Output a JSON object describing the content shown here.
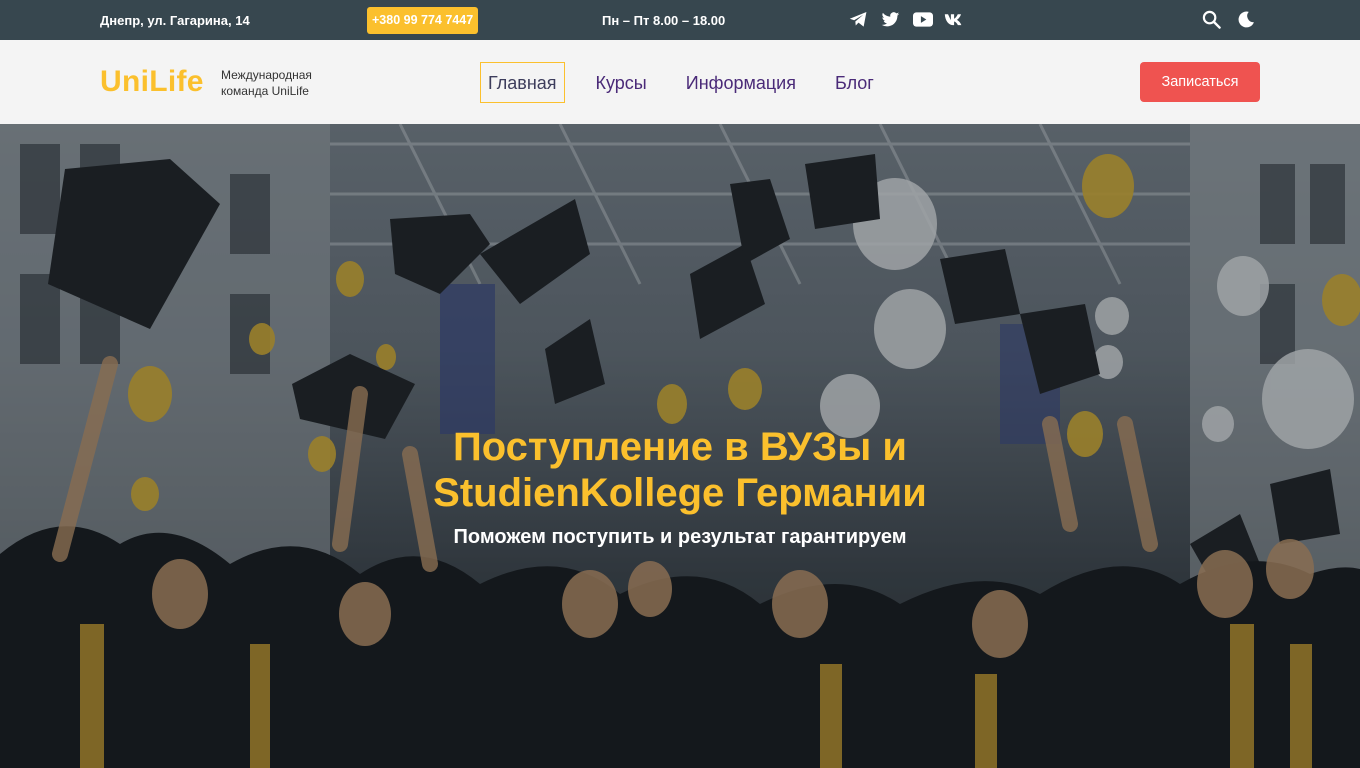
{
  "topbar": {
    "address": "Днепр, ул. Гагарина, 14",
    "phone": "+380 99 774 7447",
    "hours": "Пн – Пт 8.00 – 18.00",
    "socials": [
      "telegram-icon",
      "twitter-icon",
      "youtube-icon",
      "vk-icon"
    ],
    "tools": [
      "search-icon",
      "moon-icon"
    ]
  },
  "header": {
    "logo": "UniLife",
    "tagline": "Международная команда UniLife",
    "nav": [
      {
        "label": "Главная",
        "active": true
      },
      {
        "label": "Курсы",
        "active": false
      },
      {
        "label": "Информация",
        "active": false
      },
      {
        "label": "Блог",
        "active": false
      }
    ],
    "cta_label": "Записаться"
  },
  "hero": {
    "title_line1": "Поступление в ВУЗы и",
    "title_line2": "StudienKollege Германии",
    "subtitle": "Поможем поступить и результат гарантируем",
    "image": "graduates-throwing-caps-photo"
  },
  "colors": {
    "topbar_bg": "#37474f",
    "accent_yellow": "#fbc02d",
    "cta_red": "#ef5350",
    "nav_text": "#4a2a78"
  }
}
